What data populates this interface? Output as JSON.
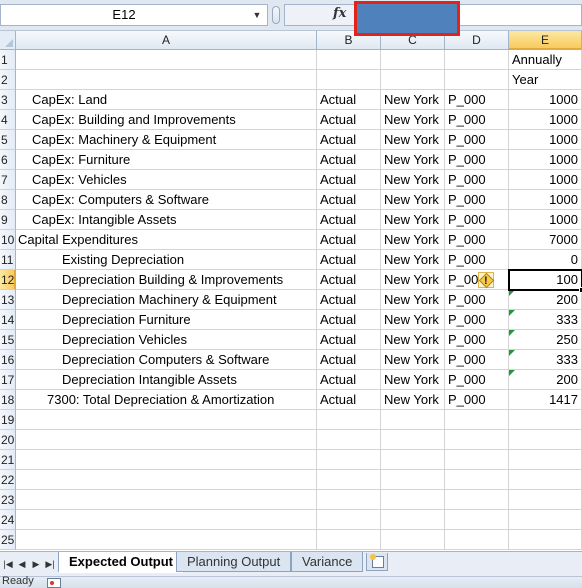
{
  "formula_bar": {
    "name_box": "E12",
    "fx_label": "fx"
  },
  "columns": [
    "A",
    "B",
    "C",
    "D",
    "E"
  ],
  "active_column": "E",
  "active_row": "12",
  "row_numbers": [
    "1",
    "2",
    "3",
    "4",
    "5",
    "6",
    "7",
    "8",
    "9",
    "10",
    "11",
    "12",
    "13",
    "14",
    "15",
    "16",
    "17",
    "18",
    "19",
    "20",
    "21",
    "22",
    "23",
    "24",
    "25"
  ],
  "rows": [
    {
      "a": "",
      "b": "",
      "c": "",
      "d": "",
      "e": "Annually"
    },
    {
      "a": "",
      "b": "",
      "c": "",
      "d": "",
      "e": "Year"
    },
    {
      "a": "CapEx: Land",
      "b": "Actual",
      "c": "New York",
      "d": "P_000",
      "e": "1000"
    },
    {
      "a": "CapEx: Building and Improvements",
      "b": "Actual",
      "c": "New York",
      "d": "P_000",
      "e": "1000"
    },
    {
      "a": "CapEx: Machinery & Equipment",
      "b": "Actual",
      "c": "New York",
      "d": "P_000",
      "e": "1000"
    },
    {
      "a": "CapEx: Furniture",
      "b": "Actual",
      "c": "New York",
      "d": "P_000",
      "e": "1000"
    },
    {
      "a": "CapEx: Vehicles",
      "b": "Actual",
      "c": "New York",
      "d": "P_000",
      "e": "1000"
    },
    {
      "a": "CapEx: Computers & Software",
      "b": "Actual",
      "c": "New York",
      "d": "P_000",
      "e": "1000"
    },
    {
      "a": "CapEx: Intangible Assets",
      "b": "Actual",
      "c": "New York",
      "d": "P_000",
      "e": "1000"
    },
    {
      "a": "Capital Expenditures",
      "b": "Actual",
      "c": "New York",
      "d": "P_000",
      "e": "7000"
    },
    {
      "a": "Existing Depreciation",
      "b": "Actual",
      "c": "New York",
      "d": "P_000",
      "e": "0"
    },
    {
      "a": "Depreciation Building & Improvements",
      "b": "Actual",
      "c": "New York",
      "d": "P_00",
      "e": "100"
    },
    {
      "a": "Depreciation Machinery & Equipment",
      "b": "Actual",
      "c": "New York",
      "d": "P_000",
      "e": "200"
    },
    {
      "a": "Depreciation Furniture",
      "b": "Actual",
      "c": "New York",
      "d": "P_000",
      "e": "333"
    },
    {
      "a": "Depreciation Vehicles",
      "b": "Actual",
      "c": "New York",
      "d": "P_000",
      "e": "250"
    },
    {
      "a": "Depreciation Computers & Software",
      "b": "Actual",
      "c": "New York",
      "d": "P_000",
      "e": "333"
    },
    {
      "a": "Depreciation Intangible Assets",
      "b": "Actual",
      "c": "New York",
      "d": "P_000",
      "e": "200"
    },
    {
      "a": "7300: Total Depreciation & Amortization",
      "b": "Actual",
      "c": "New York",
      "d": "P_000",
      "e": "1417"
    }
  ],
  "sheet_tabs": [
    "Expected Output",
    "Planning Output",
    "Variance"
  ],
  "active_sheet": "Expected Output",
  "status": {
    "ready": "Ready"
  },
  "icons": {
    "namebox_dropdown": "chevron-down-icon",
    "function": "fx-icon",
    "error_indicator": "warning-diamond-icon",
    "insert_sheet": "insert-worksheet-icon",
    "macro": "macro-record-icon"
  },
  "colors": {
    "formula_highlight_fill": "#4f81bd",
    "formula_highlight_border": "#e2231a",
    "active_header": "#f8cb5e",
    "error_triangle": "#1e9a3b"
  }
}
